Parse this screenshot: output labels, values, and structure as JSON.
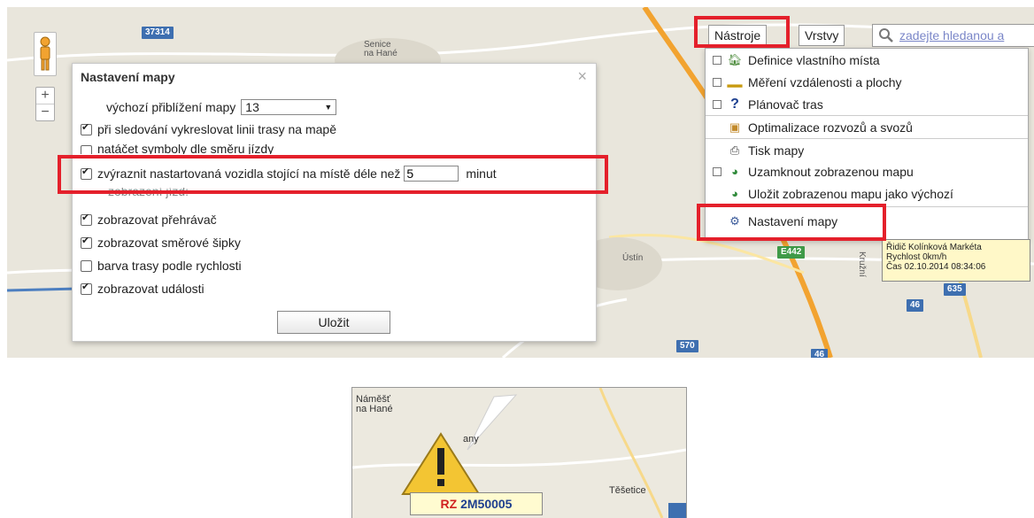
{
  "map": {
    "labels": {
      "senice": "Senice\nna Hané",
      "ustin": "Ústín",
      "kruzni": "Kružní"
    },
    "shields": {
      "r37314": "37314",
      "e442": "E442",
      "r635": "635",
      "r46a": "46",
      "r570": "570",
      "r46b": "46"
    },
    "zoom_in": "+",
    "zoom_out": "−"
  },
  "dialog": {
    "title": "Nastavení mapy",
    "close": "×",
    "default_zoom_label": "výchozí přiblížení mapy",
    "default_zoom_value": "13",
    "options": [
      {
        "label": "při sledování vykreslovat linii trasy na mapě",
        "checked": true
      },
      {
        "label": "natáčet symboly dle směru jízdy",
        "checked": false
      },
      {
        "label": "zvýraznit nastartovaná vozidla stojící na místě déle než",
        "checked": true
      },
      {
        "label": "zobrazení jízd:",
        "checked": false
      },
      {
        "label": "zobrazovat přehrávač",
        "checked": true
      },
      {
        "label": "zobrazovat směrové šipky",
        "checked": true
      },
      {
        "label": "barva trasy podle rychlosti",
        "checked": false
      },
      {
        "label": "zobrazovat události",
        "checked": true
      }
    ],
    "minutes_value": "5",
    "minutes_unit": "minut",
    "save": "Uložit"
  },
  "toolbar": {
    "tools": "Nástroje",
    "layers": "Vrstvy",
    "search_placeholder": "zadejte hledanou a"
  },
  "tools_menu": {
    "items": [
      {
        "label": "Definice vlastního místa",
        "checkbox": true,
        "icon": "house-icon"
      },
      {
        "label": "Měření vzdálenosti a plochy",
        "checkbox": true,
        "icon": "ruler-icon"
      },
      {
        "label": "Plánovač tras",
        "checkbox": true,
        "icon": "question-icon"
      },
      {
        "label": "Optimalizace rozvozů a svozů",
        "checkbox": false,
        "icon": "package-icon"
      },
      {
        "label": "Tisk mapy",
        "checkbox": false,
        "icon": "printer-icon"
      },
      {
        "label": "Uzamknout zobrazenou mapu",
        "checkbox": true,
        "icon": "globe-lock-icon"
      },
      {
        "label": "Uložit zobrazenou mapu jako výchozí",
        "checkbox": false,
        "icon": "globe-save-icon"
      },
      {
        "label": "Nastavení mapy",
        "checkbox": false,
        "icon": "gears-icon"
      }
    ]
  },
  "vehicle_tooltip": {
    "driver": "Řidič Kolínková Markéta",
    "speed": "Rychlost 0km/h",
    "time": "Čas 02.10.2014 08:34:06"
  },
  "zoomed_crop": {
    "place_1": "Náměšť\nna Hané",
    "place_2": "any",
    "place_3": "Těšetice",
    "plate_prefix": "RZ",
    "plate": "2M50005"
  },
  "colors": {
    "highlight": "#e4202b",
    "map_bg": "#eae8e0",
    "motorway": "#f2a330",
    "road_shield": "#3e6fb0",
    "green_shield": "#3f9a48"
  }
}
